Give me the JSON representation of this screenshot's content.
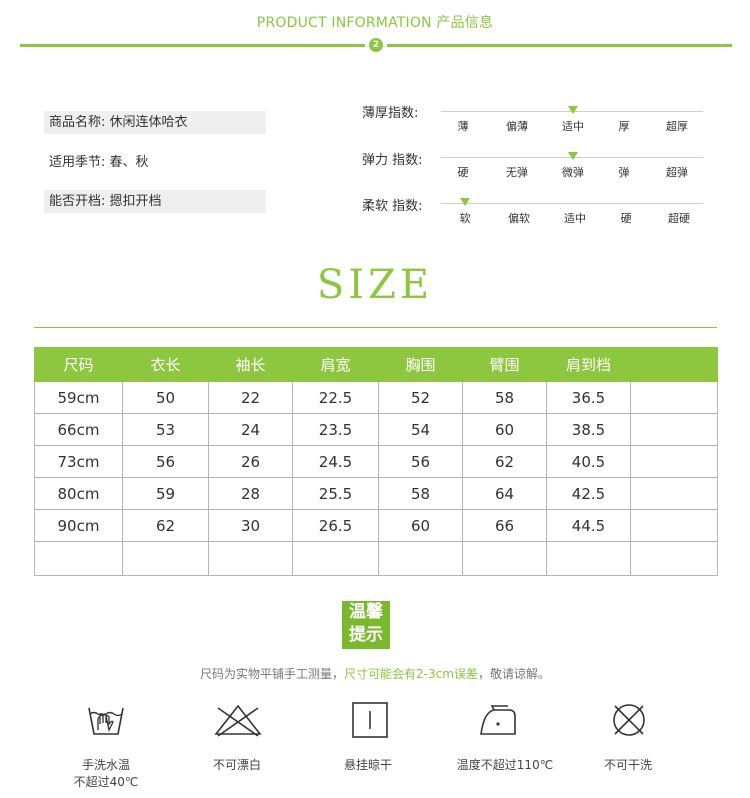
{
  "header": {
    "title": "PRODUCT INFORMATION 产品信息",
    "step": "2",
    "accent": "#8dc63f"
  },
  "info": [
    {
      "label": "商品名称: 休闲连体哈衣"
    },
    {
      "label": "适用季节: 春、秋"
    },
    {
      "label": "能否开档: 摁扣开档"
    }
  ],
  "indices": [
    {
      "label": "薄厚指数:",
      "options": [
        "薄",
        "偏薄",
        "适中",
        "厚",
        "超厚"
      ],
      "selected_index": 2
    },
    {
      "label": "弹力 指数:",
      "options": [
        "硬",
        "无弹",
        "微弹",
        "弹",
        "超弹"
      ],
      "selected_index": 2
    },
    {
      "label": "柔软 指数:",
      "options": [
        "软",
        "偏软",
        "适中",
        "硬",
        "超硬"
      ],
      "selected_index": 0
    }
  ],
  "size": {
    "title": "SIZE",
    "headers": [
      "尺码",
      "衣长",
      "袖长",
      "肩宽",
      "胸围",
      "臂围",
      "肩到档",
      ""
    ],
    "rows": [
      [
        "59cm",
        "50",
        "22",
        "22.5",
        "52",
        "58",
        "36.5",
        ""
      ],
      [
        "66cm",
        "53",
        "24",
        "23.5",
        "54",
        "60",
        "38.5",
        ""
      ],
      [
        "73cm",
        "56",
        "26",
        "24.5",
        "56",
        "62",
        "40.5",
        ""
      ],
      [
        "80cm",
        "59",
        "28",
        "25.5",
        "58",
        "64",
        "42.5",
        ""
      ],
      [
        "90cm",
        "62",
        "30",
        "26.5",
        "60",
        "66",
        "44.5",
        ""
      ],
      [
        "",
        "",
        "",
        "",
        "",
        "",
        "",
        ""
      ]
    ]
  },
  "tip": {
    "badge_line1": "温馨",
    "badge_line2": "提示",
    "note_prefix": "尺码为实物平铺手工测量，",
    "note_highlight": "尺寸可能会有2-3cm误差",
    "note_suffix": "，敬请谅解。"
  },
  "care": [
    {
      "icon": "hand-wash-icon",
      "line1": "手洗水温",
      "line2": "不超过40℃"
    },
    {
      "icon": "no-bleach-icon",
      "line1": "不可漂白",
      "line2": ""
    },
    {
      "icon": "hang-dry-icon",
      "line1": "悬挂晾干",
      "line2": ""
    },
    {
      "icon": "iron-icon",
      "line1": "温度不超过110℃",
      "line2": ""
    },
    {
      "icon": "no-dry-clean-icon",
      "line1": "不可干洗",
      "line2": ""
    }
  ]
}
